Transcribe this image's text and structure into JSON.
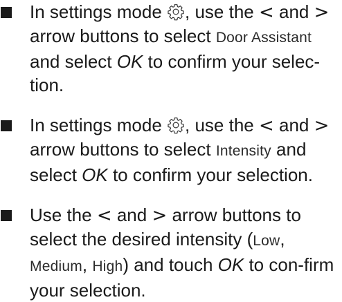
{
  "steps": [
    {
      "t1": "In settings mode ",
      "t2": ", use the ",
      "a1": "<",
      "t3": " and ",
      "a2": ">",
      "t4": " arrow buttons to select ",
      "display": "Door Assistant",
      "t5": " and select ",
      "key": "OK",
      "t6": " to confirm your selec-tion."
    },
    {
      "t1": "In settings mode ",
      "t2": ", use the ",
      "a1": "<",
      "t3": " and ",
      "a2": ">",
      "t4": " arrow buttons to select ",
      "display": "Intensity",
      "t5": " and select ",
      "key": "OK",
      "t6": " to confirm your selection."
    },
    {
      "t1": "Use the ",
      "a1": "<",
      "t2": " and ",
      "a2": ">",
      "t3": " arrow buttons to select the desired intensity (",
      "opt1": "Low",
      "sep1": ", ",
      "opt2": "Medium",
      "sep2": ", ",
      "opt3": "High",
      "t4": ") and touch ",
      "key": "OK",
      "t5": " to con-firm your selection."
    }
  ],
  "icons": {
    "settings": "gear-icon"
  }
}
